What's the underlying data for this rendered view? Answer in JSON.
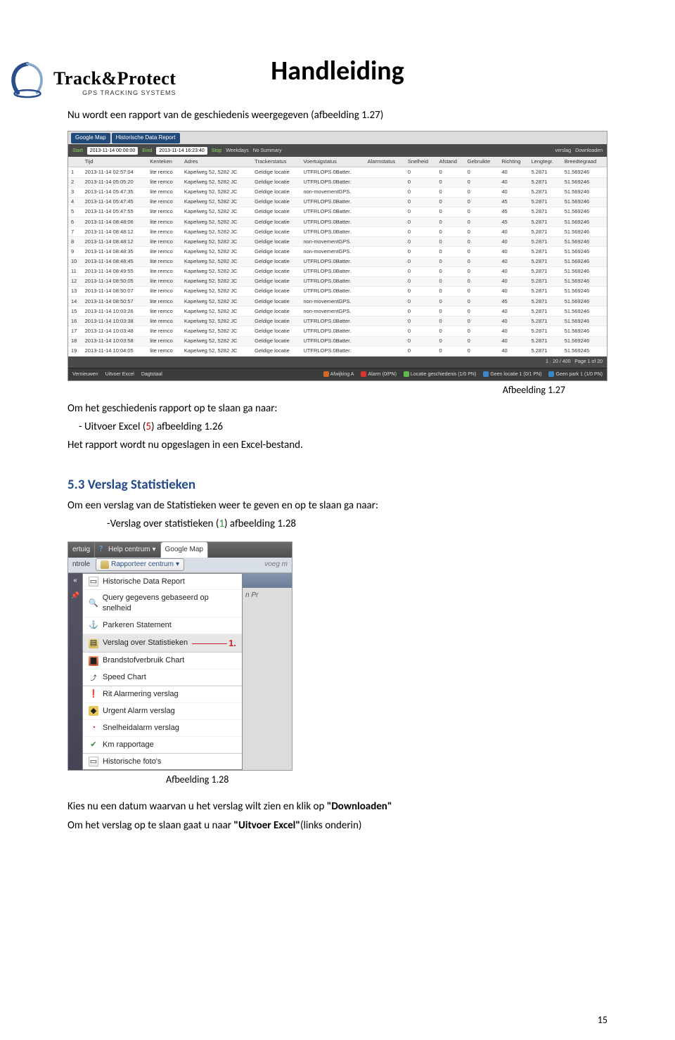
{
  "logo": {
    "brand": "Track&Protect",
    "sub": "GPS TRACKING SYSTEMS"
  },
  "title": "Handleiding",
  "intro_line": "Nu wordt een rapport van de geschiedenis weergegeven (afbeelding 1.27)",
  "caption27": "Afbeelding 1.27",
  "save_intro": "Om het geschiedenis rapport op te slaan ga naar:",
  "save_bullet_pre": "-    Uitvoer Excel (",
  "save_bullet_num": "5",
  "save_bullet_post": ") afbeelding 1.26",
  "save_note": "Het rapport wordt nu opgeslagen in een Excel-bestand.",
  "section53": "5.3 Verslag Statistieken",
  "section53_intro": "Om een verslag van de Statistieken weer te geven en op te slaan ga naar:",
  "section53_bullet_pre": "-Verslag over statistieken (",
  "section53_bullet_num": "1",
  "section53_bullet_post": ")  afbeelding 1.28",
  "caption28": "Afbeelding 1.28",
  "closing_line1_pre": "Kies nu een datum waarvan u het verslag wilt zien en klik op ",
  "closing_line1_bold": "\"Downloaden\"",
  "closing_line2_pre": "Om het verslag op te slaan gaat u naar ",
  "closing_line2_bold": "\"Uitvoer Excel\"",
  "closing_line2_post": "(links onderin)",
  "page_number": "15",
  "report": {
    "tab1": "Google Map",
    "tab2": "Historische Data Report",
    "toolbar": {
      "start_label": "Start",
      "start_val": "2013-11-14 00:00:00",
      "end_label": "Eind",
      "end_val": "2013-11-14 16:23:40",
      "stop": "Stop",
      "weekday": "Weekdays",
      "no_summary": "No Summary",
      "verslag": "verslag",
      "downloaden": "Downloaden"
    },
    "columns": [
      "",
      "Tijd",
      "Kenteken",
      "Adres",
      "Trackerstatus",
      "Voertuigstatus",
      "Alarmstatus",
      "Snelheid",
      "Afstand",
      "Gebruikte",
      "Richting",
      "Lengtegr.",
      "Breedtegraad"
    ],
    "footer": {
      "vf1": "Vernieuwen",
      "vf2": "Uitvoer Excel",
      "vf3": "Dagtotaal",
      "leg_a": "Afwijking A",
      "leg_b": "Alarm (0/PN)",
      "leg_c": "Locatie geschiedenis (1/0 PN)",
      "leg_d": "Geen locatie 1 (0/1 PN)",
      "leg_e": "Geen park 1 (1/0 PN)"
    }
  },
  "chart_data": {
    "type": "table",
    "columns": [
      "#",
      "Tijd",
      "Kenteken",
      "Adres",
      "Trackerstatus",
      "Voertuigstatus",
      "Alarmstatus",
      "Snelheid",
      "Afstand",
      "Gebruikte",
      "Richting",
      "Lengtegr.",
      "Breedtegraad"
    ],
    "rows": [
      [
        "1",
        "2013-11-14 02:57:04",
        "lite remco",
        "Kapelweg 52, 5282 JC",
        "Geldige locatie",
        "UTFRLOPS.0Batter.",
        "",
        "0",
        "0",
        "0",
        "40",
        "5.2871",
        "51.569246"
      ],
      [
        "2",
        "2013-11-14 05:05:20",
        "lite remco",
        "Kapelweg 52, 5282 JC",
        "Geldige locatie",
        "UTFRLOPS.0Batter.",
        "",
        "0",
        "0",
        "0",
        "40",
        "5.2871",
        "51.569246"
      ],
      [
        "3",
        "2013-11-14 05:47:35",
        "lite remco",
        "Kapelweg 52, 5282 JC",
        "Geldige locatie",
        "non-movementGPS.",
        "",
        "0",
        "0",
        "0",
        "40",
        "5.2871",
        "51.569246"
      ],
      [
        "4",
        "2013-11-14 05:47:45",
        "lite remco",
        "Kapelweg 52, 5282 JC",
        "Geldige locatie",
        "UTFRLOPS.0Batter.",
        "",
        "0",
        "0",
        "0",
        "45",
        "5.2871",
        "51.569246"
      ],
      [
        "5",
        "2013-11-14 05:47:55",
        "lite remco",
        "Kapelweg 52, 5282 JC",
        "Geldige locatie",
        "UTFRLOPS.0Batter.",
        "",
        "0",
        "0",
        "0",
        "45",
        "5.2871",
        "51.569246"
      ],
      [
        "6",
        "2013-11-14 08:48:06",
        "lite remco",
        "Kapelweg 52, 5282 JC",
        "Geldige locatie",
        "UTFRLOPS.0Batter.",
        "",
        "0",
        "0",
        "0",
        "45",
        "5.2871",
        "51.569246"
      ],
      [
        "7",
        "2013-11-14 08:48:12",
        "lite remco",
        "Kapelweg 52, 5282 JC",
        "Geldige locatie",
        "UTFRLOPS.0Batter.",
        "",
        "0",
        "0",
        "0",
        "40",
        "5.2871",
        "51.569246"
      ],
      [
        "8",
        "2013-11-14 08:48:12",
        "lite remco",
        "Kapelweg 52, 5282 JC",
        "Geldige locatie",
        "non-movementGPS.",
        "",
        "0",
        "0",
        "0",
        "40",
        "5.2871",
        "51.569246"
      ],
      [
        "9",
        "2013-11-14 08:48:35",
        "lite remco",
        "Kapelweg 52, 5282 JC",
        "Geldige locatie",
        "non-movementGPS.",
        "",
        "0",
        "0",
        "0",
        "40",
        "5.2871",
        "51.569246"
      ],
      [
        "10",
        "2013-11-14 08:48:45",
        "lite remco",
        "Kapelweg 52, 5282 JC",
        "Geldige locatie",
        "UTFRLOPS.0Batter.",
        "",
        "0",
        "0",
        "0",
        "40",
        "5.2871",
        "51.569246"
      ],
      [
        "11",
        "2013-11-14 08:49:55",
        "lite remco",
        "Kapelweg 52, 5282 JC",
        "Geldige locatie",
        "UTFRLOPS.0Batter.",
        "",
        "0",
        "0",
        "0",
        "40",
        "5.2871",
        "51.569246"
      ],
      [
        "12",
        "2013-11-14 08:50:05",
        "lite remco",
        "Kapelweg 52, 5282 JC",
        "Geldige locatie",
        "UTFRLOPS.0Batter.",
        "",
        "0",
        "0",
        "0",
        "40",
        "5.2871",
        "51.569246"
      ],
      [
        "13",
        "2013-11-14 08:50:07",
        "lite remco",
        "Kapelweg 52, 5282 JC",
        "Geldige locatie",
        "UTFRLOPS.0Batter.",
        "",
        "0",
        "0",
        "0",
        "40",
        "5.2871",
        "51.569246"
      ],
      [
        "14",
        "2013-11-14 08:50:57",
        "lite remco",
        "Kapelweg 52, 5282 JC",
        "Geldige locatie",
        "non-movementGPS.",
        "",
        "0",
        "0",
        "0",
        "45",
        "5.2871",
        "51.569246"
      ],
      [
        "15",
        "2013-11-14 10:03:26",
        "lite remco",
        "Kapelweg 52, 5282 JC",
        "Geldige locatie",
        "non-movementGPS.",
        "",
        "0",
        "0",
        "0",
        "40",
        "5.2871",
        "51.569246"
      ],
      [
        "16",
        "2013-11-14 10:03:38",
        "lite remco",
        "Kapelweg 52, 5282 JC",
        "Geldige locatie",
        "UTFRLOPS.0Batter.",
        "",
        "0",
        "0",
        "0",
        "40",
        "5.2871",
        "51.569246"
      ],
      [
        "17",
        "2013-11-14 10:03:48",
        "lite remco",
        "Kapelweg 52, 5282 JC",
        "Geldige locatie",
        "UTFRLOPS.0Batter.",
        "",
        "0",
        "0",
        "0",
        "40",
        "5.2871",
        "51.569246"
      ],
      [
        "18",
        "2013-11-14 10:03:58",
        "lite remco",
        "Kapelweg 52, 5282 JC",
        "Geldige locatie",
        "UTFRLOPS.0Batter.",
        "",
        "0",
        "0",
        "0",
        "40",
        "5.2871",
        "51.569246"
      ],
      [
        "19",
        "2013-11-14 10:04:05",
        "lite remco",
        "Kapelweg 52, 5282 JC",
        "Geldige locatie",
        "UTFRLOPS.0Batter.",
        "",
        "0",
        "0",
        "0",
        "40",
        "5.2871",
        "51.569245"
      ]
    ]
  },
  "menu28": {
    "top": {
      "ertuig": "ertuig",
      "help": "Help centrum",
      "gmap": "Google Map"
    },
    "ntrole": "ntrole",
    "rapporteer": "Rapporteer centrum",
    "right_voeg": "voeg m",
    "right_pr": "n   Pr",
    "items": [
      {
        "icon": "page",
        "label": "Historische Data Report"
      },
      {
        "icon": "search",
        "label": "Query gegevens gebaseerd op snelheid"
      },
      {
        "icon": "anchor",
        "label": "Parkeren Statement"
      },
      {
        "icon": "stat",
        "label": "Verslag over Statistieken",
        "callout": "1."
      },
      {
        "icon": "fuel",
        "label": "Brandstofverbruik Chart"
      },
      {
        "icon": "speed",
        "label": "Speed Chart"
      },
      {
        "icon": "warn",
        "label": "Rit Alarmering verslag"
      },
      {
        "icon": "urgent",
        "label": "Urgent Alarm verslag"
      },
      {
        "icon": "gauge",
        "label": "Snelheidalarm verslag"
      },
      {
        "icon": "km",
        "label": "Km rapportage"
      },
      {
        "icon": "page",
        "label": "Historische foto's"
      }
    ]
  }
}
